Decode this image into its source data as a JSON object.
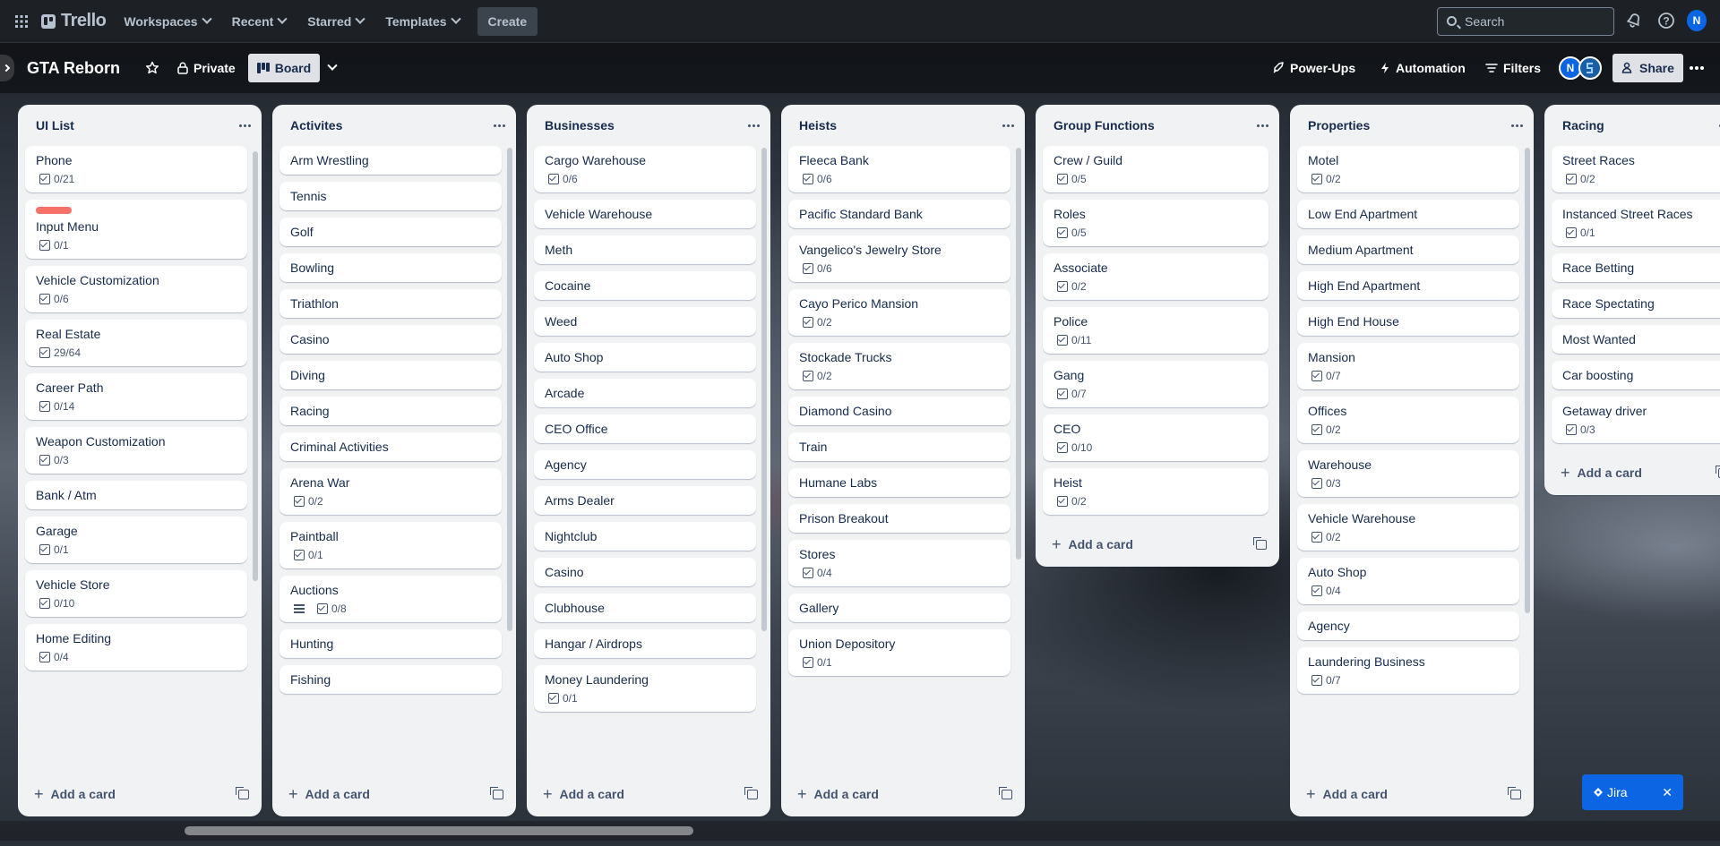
{
  "nav": {
    "brand": "Trello",
    "workspaces": "Workspaces",
    "recent": "Recent",
    "starred": "Starred",
    "templates": "Templates",
    "create": "Create",
    "search_placeholder": "Search",
    "avatar_initial": "N"
  },
  "board": {
    "title": "GTA Reborn",
    "visibility": "Private",
    "view": "Board",
    "powerups": "Power-Ups",
    "automation": "Automation",
    "filters": "Filters",
    "member_initial": "N",
    "share": "Share"
  },
  "add_card_label": "Add a card",
  "jira": {
    "label": "Jira"
  },
  "colors": {
    "label_red": "#f87168",
    "accent_blue": "#0c66e4"
  },
  "lists": [
    {
      "title": "UI List",
      "cards": [
        {
          "title": "Phone",
          "checklist": "0/21"
        },
        {
          "title": "Input Menu",
          "checklist": "0/1",
          "label": "red"
        },
        {
          "title": "Vehicle Customization",
          "checklist": "0/6"
        },
        {
          "title": "Real Estate",
          "checklist": "29/64"
        },
        {
          "title": "Career Path",
          "checklist": "0/14"
        },
        {
          "title": "Weapon Customization",
          "checklist": "0/3"
        },
        {
          "title": "Bank / Atm"
        },
        {
          "title": "Garage",
          "checklist": "0/1"
        },
        {
          "title": "Vehicle Store",
          "checklist": "0/10"
        },
        {
          "title": "Home Editing",
          "checklist": "0/4"
        }
      ]
    },
    {
      "title": "Activites",
      "cards": [
        {
          "title": "Arm Wrestling"
        },
        {
          "title": "Tennis"
        },
        {
          "title": "Golf"
        },
        {
          "title": "Bowling"
        },
        {
          "title": "Triathlon"
        },
        {
          "title": "Casino"
        },
        {
          "title": "Diving"
        },
        {
          "title": "Racing"
        },
        {
          "title": "Criminal Activities"
        },
        {
          "title": "Arena War",
          "checklist": "0/2"
        },
        {
          "title": "Paintball",
          "checklist": "0/1"
        },
        {
          "title": "Auctions",
          "checklist": "0/8",
          "description": true
        },
        {
          "title": "Hunting"
        },
        {
          "title": "Fishing"
        }
      ]
    },
    {
      "title": "Businesses",
      "cards": [
        {
          "title": "Cargo Warehouse",
          "checklist": "0/6"
        },
        {
          "title": "Vehicle Warehouse"
        },
        {
          "title": "Meth"
        },
        {
          "title": "Cocaine"
        },
        {
          "title": "Weed"
        },
        {
          "title": "Auto Shop"
        },
        {
          "title": "Arcade"
        },
        {
          "title": "CEO Office"
        },
        {
          "title": "Agency"
        },
        {
          "title": "Arms Dealer"
        },
        {
          "title": "Nightclub"
        },
        {
          "title": "Casino"
        },
        {
          "title": "Clubhouse"
        },
        {
          "title": "Hangar / Airdrops"
        },
        {
          "title": "Money Laundering",
          "checklist": "0/1"
        }
      ]
    },
    {
      "title": "Heists",
      "cards": [
        {
          "title": "Fleeca Bank",
          "checklist": "0/6"
        },
        {
          "title": "Pacific Standard Bank"
        },
        {
          "title": "Vangelico's Jewelry Store",
          "checklist": "0/6"
        },
        {
          "title": "Cayo Perico Mansion",
          "checklist": "0/2"
        },
        {
          "title": "Stockade Trucks",
          "checklist": "0/2"
        },
        {
          "title": "Diamond Casino"
        },
        {
          "title": "Train"
        },
        {
          "title": "Humane Labs"
        },
        {
          "title": "Prison Breakout"
        },
        {
          "title": "Stores",
          "checklist": "0/4"
        },
        {
          "title": "Gallery"
        },
        {
          "title": "Union Depository",
          "checklist": "0/1"
        }
      ]
    },
    {
      "title": "Group Functions",
      "cards": [
        {
          "title": "Crew / Guild",
          "checklist": "0/5"
        },
        {
          "title": "Roles",
          "checklist": "0/5"
        },
        {
          "title": "Associate",
          "checklist": "0/2"
        },
        {
          "title": "Police",
          "checklist": "0/11"
        },
        {
          "title": "Gang",
          "checklist": "0/7"
        },
        {
          "title": "CEO",
          "checklist": "0/10"
        },
        {
          "title": "Heist",
          "checklist": "0/2"
        }
      ]
    },
    {
      "title": "Properties",
      "cards": [
        {
          "title": "Motel",
          "checklist": "0/2"
        },
        {
          "title": "Low End Apartment"
        },
        {
          "title": "Medium Apartment"
        },
        {
          "title": "High End Apartment"
        },
        {
          "title": "High End House"
        },
        {
          "title": "Mansion",
          "checklist": "0/7"
        },
        {
          "title": "Offices",
          "checklist": "0/2"
        },
        {
          "title": "Warehouse",
          "checklist": "0/3"
        },
        {
          "title": "Vehicle Warehouse",
          "checklist": "0/2"
        },
        {
          "title": "Auto Shop",
          "checklist": "0/4"
        },
        {
          "title": "Agency"
        },
        {
          "title": "Laundering Business",
          "checklist": "0/7"
        }
      ]
    },
    {
      "title": "Racing",
      "cards": [
        {
          "title": "Street Races",
          "checklist": "0/2"
        },
        {
          "title": "Instanced Street Races",
          "checklist": "0/1"
        },
        {
          "title": "Race Betting"
        },
        {
          "title": "Race Spectating"
        },
        {
          "title": "Most Wanted"
        },
        {
          "title": "Car boosting"
        },
        {
          "title": "Getaway driver",
          "checklist": "0/3"
        }
      ]
    }
  ]
}
